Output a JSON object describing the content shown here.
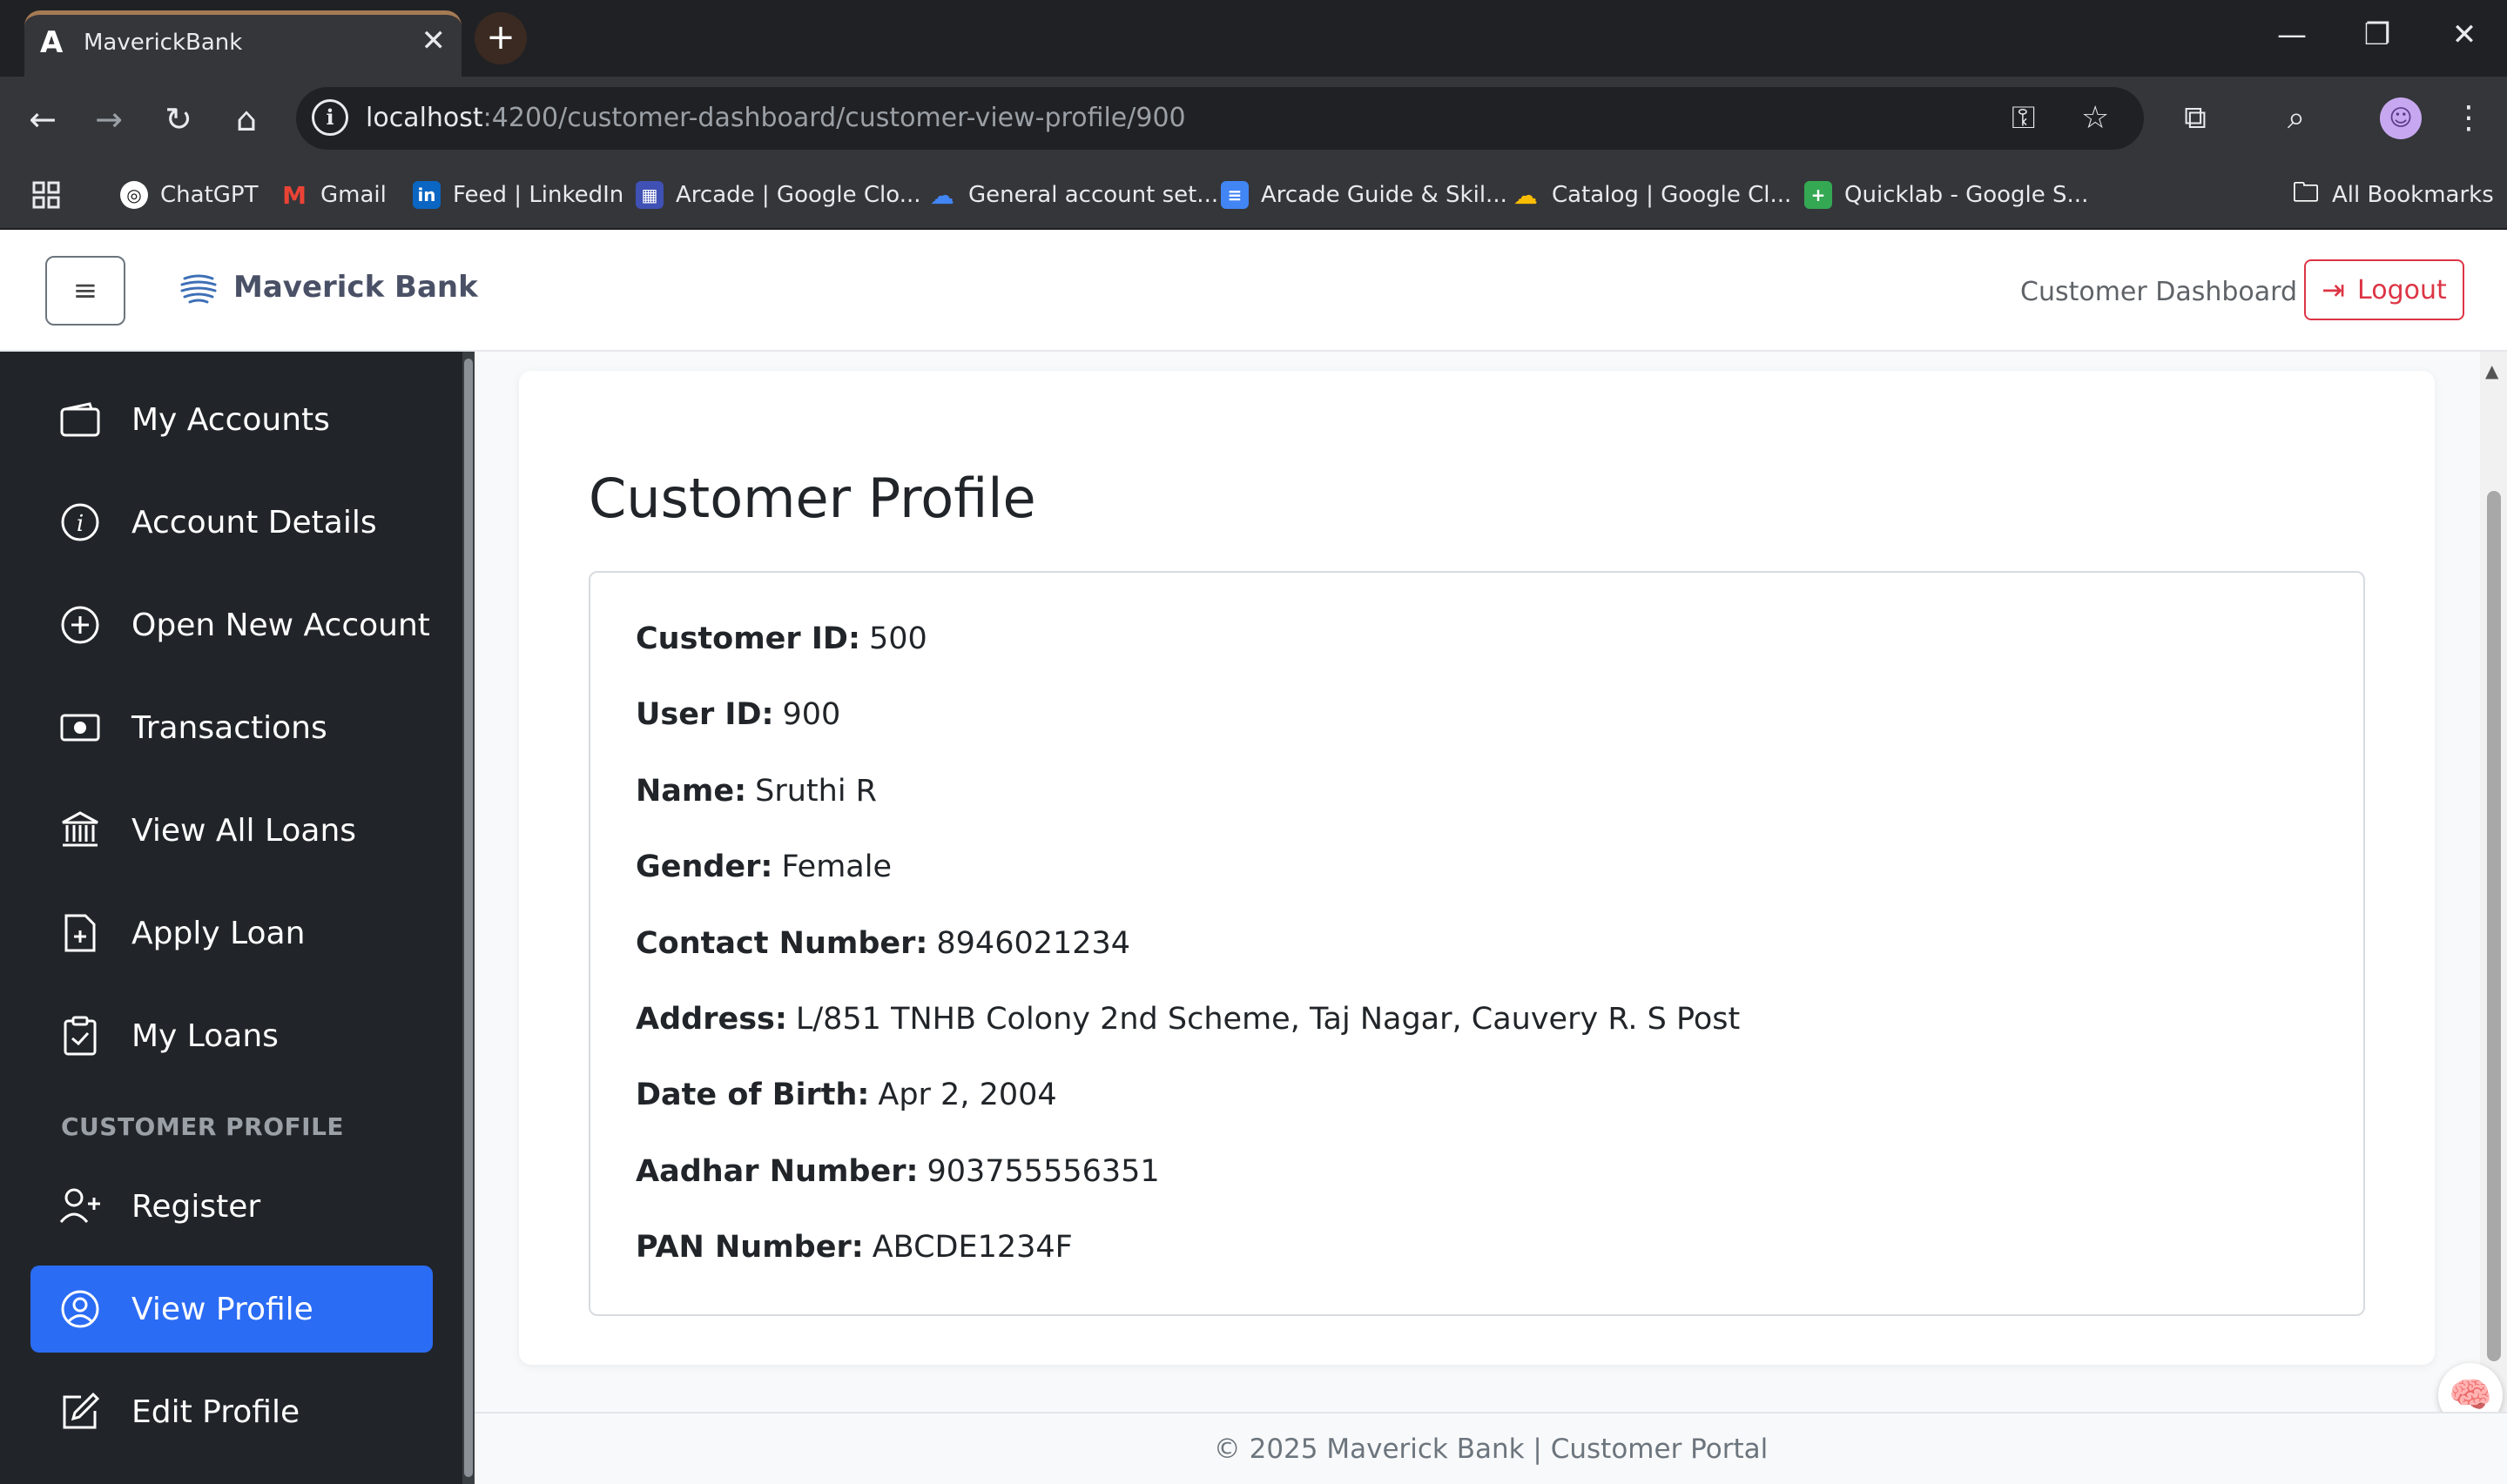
{
  "browser": {
    "tab_title": "MaverickBank",
    "url_host": "localhost",
    "url_path": ":4200/customer-dashboard/customer-view-profile/900",
    "bookmarks": [
      {
        "label": "ChatGPT",
        "icon": "chatgpt-icon"
      },
      {
        "label": "Gmail",
        "icon": "gmail-icon"
      },
      {
        "label": "Feed | LinkedIn",
        "icon": "linkedin-icon"
      },
      {
        "label": "Arcade | Google Clo...",
        "icon": "arcade-icon"
      },
      {
        "label": "General account set...",
        "icon": "google-cloud-icon"
      },
      {
        "label": "Arcade Guide & Skil...",
        "icon": "docs-icon"
      },
      {
        "label": "Catalog | Google Cl...",
        "icon": "google-cloud-icon"
      },
      {
        "label": "Quicklab - Google S...",
        "icon": "sheets-icon"
      }
    ],
    "all_bookmarks": "All Bookmarks"
  },
  "header": {
    "brand": "Maverick Bank",
    "dashboard_link": "Customer Dashboard",
    "logout": "Logout"
  },
  "sidebar": {
    "items": [
      {
        "label": "My Accounts",
        "icon": "wallet-icon"
      },
      {
        "label": "Account Details",
        "icon": "info-icon"
      },
      {
        "label": "Open New Account",
        "icon": "plus-circle-icon"
      },
      {
        "label": "Transactions",
        "icon": "cash-icon"
      },
      {
        "label": "View All Loans",
        "icon": "bank-icon"
      },
      {
        "label": "Apply Loan",
        "icon": "file-plus-icon"
      },
      {
        "label": "My Loans",
        "icon": "clipboard-check-icon"
      }
    ],
    "section_heading": "CUSTOMER PROFILE",
    "profile_items": [
      {
        "label": "Register",
        "icon": "person-plus-icon"
      },
      {
        "label": "View Profile",
        "icon": "person-circle-icon",
        "active": true
      },
      {
        "label": "Edit Profile",
        "icon": "pencil-square-icon"
      }
    ]
  },
  "profile": {
    "title": "Customer Profile",
    "fields": [
      {
        "label": "Customer ID:",
        "value": "500"
      },
      {
        "label": "User ID:",
        "value": "900"
      },
      {
        "label": "Name:",
        "value": "Sruthi R"
      },
      {
        "label": "Gender:",
        "value": "Female"
      },
      {
        "label": "Contact Number:",
        "value": "8946021234"
      },
      {
        "label": "Address:",
        "value": "L/851 TNHB Colony 2nd Scheme, Taj Nagar, Cauvery R. S Post"
      },
      {
        "label": "Date of Birth:",
        "value": "Apr 2, 2004"
      },
      {
        "label": "Aadhar Number:",
        "value": "903755556351"
      },
      {
        "label": "PAN Number:",
        "value": "ABCDE1234F"
      }
    ]
  },
  "footer": {
    "text": "© 2025 Maverick Bank | Customer Portal"
  },
  "colors": {
    "sidebar_bg": "#212529",
    "active_item": "#2b6cf4",
    "logout": "#dc3545"
  }
}
